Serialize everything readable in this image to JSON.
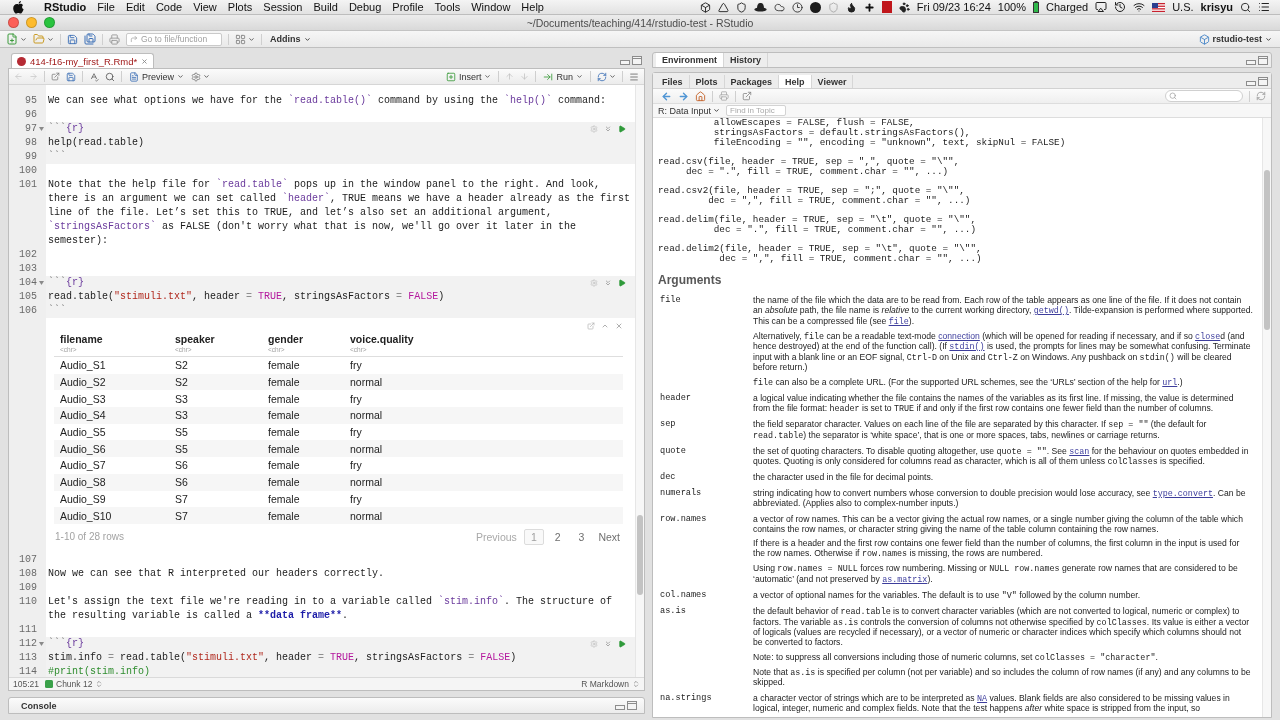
{
  "menu_bar": {
    "app_name": "RStudio",
    "menus": [
      "File",
      "Edit",
      "Code",
      "View",
      "Plots",
      "Session",
      "Build",
      "Debug",
      "Profile",
      "Tools",
      "Window",
      "Help"
    ],
    "clock": "Fri 09/23 16:24",
    "battery": "100%",
    "battery_status": "Charged",
    "input_source": "U.S.",
    "user": "krisyu"
  },
  "window": {
    "title": "~/Documents/teaching/414/rstudio-test - RStudio"
  },
  "toolbar": {
    "goto_placeholder": "Go to file/function",
    "addins": "Addins",
    "project": "rstudio-test"
  },
  "editor": {
    "tab": {
      "label": "414-f16-my_first_R.Rmd*",
      "modified": true
    },
    "toolbar": {
      "preview": "Preview",
      "insert": "Insert",
      "run": "Run"
    },
    "lines": [
      {
        "kind": "text",
        "number": "95",
        "segments": [
          "We can see what options we have for the ",
          {
            "kind": "code",
            "text": "`read.table()`"
          },
          " command by using the ",
          {
            "kind": "code",
            "text": "`help()`"
          },
          " command:"
        ]
      },
      {
        "kind": "text",
        "number": "96"
      },
      {
        "kind": "chunk-start",
        "number": "97",
        "segments": [
          {
            "kind": "fence",
            "text": "```"
          },
          {
            "kind": "code",
            "text": "{r}"
          }
        ]
      },
      {
        "kind": "chunk",
        "number": "98",
        "segments": [
          "help(read.table)"
        ]
      },
      {
        "kind": "chunk",
        "number": "99",
        "segments": [
          {
            "kind": "fence",
            "text": "```"
          }
        ]
      },
      {
        "kind": "text",
        "number": "100"
      },
      {
        "kind": "text",
        "number": "101",
        "segments": [
          "Note that the help file for ",
          {
            "kind": "code",
            "text": "`read.table`"
          },
          " pops up in the window panel to the right. And look, there is an argument we can set called ",
          {
            "kind": "code",
            "text": "`header`"
          },
          ", TRUE means we have a header already as the first line of the file. Let’s set this to TRUE, and let’s also set an additional argument, ",
          {
            "kind": "code",
            "text": "`stringsAsFactors`"
          },
          " as FALSE (don't worry what that is now, we'll go over it later in the semester):"
        ]
      },
      {
        "kind": "text",
        "number": "102"
      },
      {
        "kind": "text",
        "number": "103"
      },
      {
        "kind": "chunk-start",
        "number": "104",
        "segments": [
          {
            "kind": "fence",
            "text": "```"
          },
          {
            "kind": "code",
            "text": "{r}"
          }
        ]
      },
      {
        "kind": "chunk",
        "number": "105",
        "segments": [
          "read.table(",
          {
            "kind": "string",
            "text": "\"stimuli.txt\""
          },
          ", header ",
          {
            "kind": "operator",
            "text": "="
          },
          {
            "kind": "constant",
            "text": " TRUE"
          },
          ", stringsAsFactors ",
          {
            "kind": "operator",
            "text": "="
          },
          {
            "kind": "constant",
            "text": " FALSE"
          },
          ")"
        ]
      },
      {
        "kind": "chunk",
        "number": "106",
        "segments": [
          {
            "kind": "fence",
            "text": "```"
          }
        ]
      },
      {
        "kind": "output",
        "table": {
          "columns": [
            {
              "name": "filename",
              "type": "<chr>"
            },
            {
              "name": "speaker",
              "type": "<chr>"
            },
            {
              "name": "gender",
              "type": "<chr>"
            },
            {
              "name": "voice.quality",
              "type": "<chr>"
            }
          ],
          "rows": [
            [
              "Audio_S1",
              "S2",
              "female",
              "fry"
            ],
            [
              "Audio_S2",
              "S2",
              "female",
              "normal"
            ],
            [
              "Audio_S3",
              "S3",
              "female",
              "fry"
            ],
            [
              "Audio_S4",
              "S3",
              "female",
              "normal"
            ],
            [
              "Audio_S5",
              "S5",
              "female",
              "fry"
            ],
            [
              "Audio_S6",
              "S5",
              "female",
              "normal"
            ],
            [
              "Audio_S7",
              "S6",
              "female",
              "fry"
            ],
            [
              "Audio_S8",
              "S6",
              "female",
              "normal"
            ],
            [
              "Audio_S9",
              "S7",
              "female",
              "fry"
            ],
            [
              "Audio_S10",
              "S7",
              "female",
              "normal"
            ]
          ],
          "summary": "1-10 of 28 rows",
          "pagination": {
            "previous": "Previous",
            "previous_disabled": true,
            "pages": [
              {
                "label": "1",
                "selected": true
              },
              {
                "label": "2",
                "selected": false
              },
              {
                "label": "3",
                "selected": false
              }
            ],
            "next": "Next"
          }
        }
      },
      {
        "kind": "text",
        "number": "107"
      },
      {
        "kind": "text",
        "number": "108",
        "segments": [
          "Now we can see that R interpreted our headers correctly."
        ]
      },
      {
        "kind": "text",
        "number": "109"
      },
      {
        "kind": "text",
        "number": "110",
        "segments": [
          "Let's assign the text file we're reading in to a variable called ",
          {
            "kind": "code",
            "text": "`stim.info`"
          },
          ". The structure of the resulting variable is called a ",
          {
            "kind": "bold",
            "text": "**data frame**"
          },
          "."
        ]
      },
      {
        "kind": "text",
        "number": "111"
      },
      {
        "kind": "chunk-start",
        "number": "112",
        "segments": [
          {
            "kind": "fence",
            "text": "```"
          },
          {
            "kind": "code",
            "text": "{r}"
          }
        ]
      },
      {
        "kind": "chunk",
        "number": "113",
        "segments": [
          "stim.info ",
          {
            "kind": "operator",
            "text": "="
          },
          " read.table(",
          {
            "kind": "string",
            "text": "\"stimuli.txt\""
          },
          ", header ",
          {
            "kind": "operator",
            "text": "="
          },
          {
            "kind": "constant",
            "text": " TRUE"
          },
          ", stringsAsFactors ",
          {
            "kind": "operator",
            "text": "="
          },
          {
            "kind": "constant",
            "text": " FALSE"
          },
          ")"
        ]
      },
      {
        "kind": "chunk",
        "number": "114",
        "segments": [
          {
            "kind": "comment",
            "text": "#print(stim.info)"
          }
        ]
      }
    ],
    "status": {
      "position": "105:21",
      "scope": "Chunk 12",
      "mode": "R Markdown"
    }
  },
  "console": {
    "title": "Console"
  },
  "environment_pane": {
    "tabs": [
      {
        "label": "Environment",
        "selected": true
      },
      {
        "label": "History",
        "selected": false
      }
    ]
  },
  "files_pane": {
    "tabs": [
      {
        "label": "Files",
        "selected": false
      },
      {
        "label": "Plots",
        "selected": false
      },
      {
        "label": "Packages",
        "selected": false
      },
      {
        "label": "Help",
        "selected": true
      },
      {
        "label": "Viewer",
        "selected": false
      }
    ],
    "topic": "R: Data Input",
    "find_placeholder": "Find in Topic",
    "usage": [
      "          allowEscapes = FALSE, flush = FALSE,\n          stringsAsFactors = default.stringsAsFactors(),\n          fileEncoding = \"\", encoding = \"unknown\", text, skipNul = FALSE)",
      "read.csv(file, header = TRUE, sep = \",\", quote = \"\\\"\",\n     dec = \".\", fill = TRUE, comment.char = \"\", ...)",
      "read.csv2(file, header = TRUE, sep = \";\", quote = \"\\\"\",\n         dec = \",\", fill = TRUE, comment.char = \"\", ...)",
      "read.delim(file, header = TRUE, sep = \"\\t\", quote = \"\\\"\",\n          dec = \".\", fill = TRUE, comment.char = \"\", ...)",
      "read.delim2(file, header = TRUE, sep = \"\\t\", quote = \"\\\"\",\n           dec = \",\", fill = TRUE, comment.char = \"\", ...)"
    ],
    "arguments_title": "Arguments",
    "arguments": [
      {
        "name": "file",
        "paragraphs": [
          [
            "the name of the file which the data are to be read from. Each row of the table appears as one line of the file. If it does not contain an ",
            {
              "kind": "em",
              "text": "absolute"
            },
            " path, the file name is ",
            {
              "kind": "em",
              "text": "relative"
            },
            " to the current working directory, ",
            {
              "kind": "code-link",
              "text": "getwd()"
            },
            ". Tilde-expansion is performed where supported. This can be a compressed file (see ",
            {
              "kind": "code-link",
              "text": "file"
            },
            ")."
          ],
          [
            "Alternatively, ",
            {
              "kind": "code",
              "text": "file"
            },
            " can be a readable text-mode ",
            {
              "kind": "link",
              "text": "connection"
            },
            " (which will be opened for reading if necessary, and if so ",
            {
              "kind": "code-link",
              "text": "close"
            },
            "d (and hence destroyed) at the end of the function call). (If ",
            {
              "kind": "code-link",
              "text": "stdin()"
            },
            " is used, the prompts for lines may be somewhat confusing. Terminate input with a blank line or an EOF signal, ",
            {
              "kind": "code",
              "text": "Ctrl-D"
            },
            " on Unix and ",
            {
              "kind": "code",
              "text": "Ctrl-Z"
            },
            " on Windows. Any pushback on ",
            {
              "kind": "code",
              "text": "stdin()"
            },
            " will be cleared before return.)"
          ],
          [
            {
              "kind": "code",
              "text": "file"
            },
            " can also be a complete URL. (For the supported URL schemes, see the ‘URLs’ section of the help for ",
            {
              "kind": "code-link",
              "text": "url"
            },
            ".)"
          ]
        ]
      },
      {
        "name": "header",
        "paragraphs": [
          [
            "a logical value indicating whether the file contains the names of the variables as its first line. If missing, the value is determined from the file format: ",
            {
              "kind": "code",
              "text": "header"
            },
            " is set to ",
            {
              "kind": "code",
              "text": "TRUE"
            },
            " if and only if the first row contains one fewer field than the number of columns."
          ]
        ]
      },
      {
        "name": "sep",
        "paragraphs": [
          [
            "the field separator character. Values on each line of the file are separated by this character. If ",
            {
              "kind": "code",
              "text": "sep = \"\""
            },
            " (the default for ",
            {
              "kind": "code",
              "text": "read.table"
            },
            ") the separator is ‘white space’, that is one or more spaces, tabs, newlines or carriage returns."
          ]
        ]
      },
      {
        "name": "quote",
        "paragraphs": [
          [
            "the set of quoting characters. To disable quoting altogether, use ",
            {
              "kind": "code",
              "text": "quote = \"\""
            },
            ". See ",
            {
              "kind": "code-link",
              "text": "scan"
            },
            " for the behaviour on quotes embedded in quotes. Quoting is only considered for columns read as character, which is all of them unless ",
            {
              "kind": "code",
              "text": "colClasses"
            },
            " is specified."
          ]
        ]
      },
      {
        "name": "dec",
        "paragraphs": [
          [
            "the character used in the file for decimal points."
          ]
        ]
      },
      {
        "name": "numerals",
        "paragraphs": [
          [
            "string indicating how to convert numbers whose conversion to double precision would lose accuracy, see ",
            {
              "kind": "code-link",
              "text": "type.convert"
            },
            ". Can be abbreviated. (Applies also to complex-number inputs.)"
          ]
        ]
      },
      {
        "name": "row.names",
        "paragraphs": [
          [
            "a vector of row names. This can be a vector giving the actual row names, or a single number giving the column of the table which contains the row names, or character string giving the name of the table column containing the row names."
          ],
          [
            "If there is a header and the first row contains one fewer field than the number of columns, the first column in the input is used for the row names. Otherwise if ",
            {
              "kind": "code",
              "text": "row.names"
            },
            " is missing, the rows are numbered."
          ],
          [
            "Using ",
            {
              "kind": "code",
              "text": "row.names = NULL"
            },
            " forces row numbering. Missing or ",
            {
              "kind": "code",
              "text": "NULL row.names"
            },
            " generate row names that are considered to be ‘automatic’ (and not preserved by ",
            {
              "kind": "code-link",
              "text": "as.matrix"
            },
            ")."
          ]
        ]
      },
      {
        "name": "col.names",
        "paragraphs": [
          [
            "a vector of optional names for the variables. The default is to use ",
            {
              "kind": "code",
              "text": "\"V\""
            },
            " followed by the column number."
          ]
        ]
      },
      {
        "name": "as.is",
        "paragraphs": [
          [
            "the default behavior of ",
            {
              "kind": "code",
              "text": "read.table"
            },
            " is to convert character variables (which are not converted to logical, numeric or complex) to factors. The variable ",
            {
              "kind": "code",
              "text": "as.is"
            },
            " controls the conversion of columns not otherwise specified by ",
            {
              "kind": "code",
              "text": "colClasses"
            },
            ". Its value is either a vector of logicals (values are recycled if necessary), or a vector of numeric or character indices which specify which columns should not be converted to factors."
          ],
          [
            "Note: to suppress all conversions including those of numeric columns, set ",
            {
              "kind": "code",
              "text": "colClasses = \"character\""
            },
            "."
          ],
          [
            "Note that ",
            {
              "kind": "code",
              "text": "as.is"
            },
            " is specified per column (not per variable) and so includes the column of row names (if any) and any columns to be skipped."
          ]
        ]
      },
      {
        "name": "na.strings",
        "paragraphs": [
          [
            "a character vector of strings which are to be interpreted as ",
            {
              "kind": "code-link",
              "text": "NA"
            },
            " values. Blank fields are also considered to be missing values in logical, integer, numeric and complex fields. Note that the test happens ",
            {
              "kind": "em",
              "text": "after"
            },
            " white space is stripped from the input, so"
          ]
        ]
      }
    ]
  }
}
